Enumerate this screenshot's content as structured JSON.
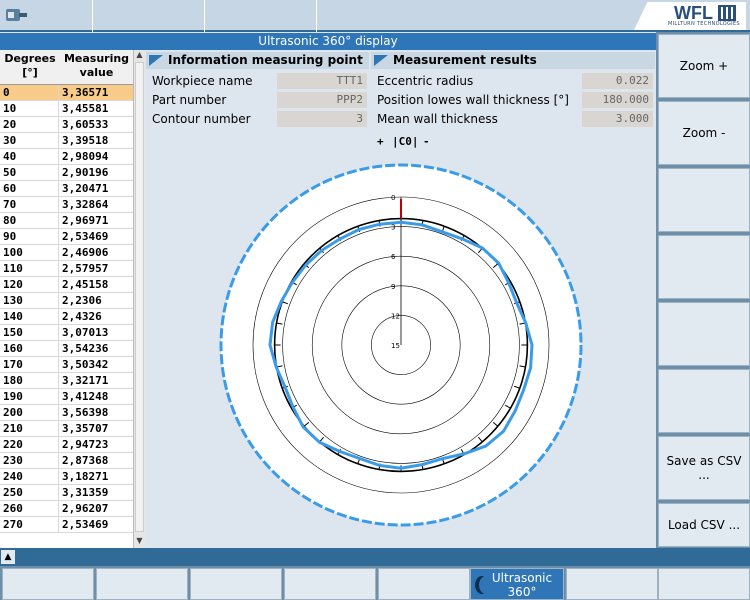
{
  "window": {
    "title": "Ultrasonic 360° display"
  },
  "logo": {
    "text": "WFL",
    "subtitle": "MILLTURN TECHNOLOGIES"
  },
  "table": {
    "col1_header": "Degrees\n[°]",
    "col2_header": "Measuring\nvalue",
    "selected_row": 0,
    "rows": [
      [
        "0",
        "3,36571"
      ],
      [
        "10",
        "3,45581"
      ],
      [
        "20",
        "3,60533"
      ],
      [
        "30",
        "3,39518"
      ],
      [
        "40",
        "2,98094"
      ],
      [
        "50",
        "2,90196"
      ],
      [
        "60",
        "3,20471"
      ],
      [
        "70",
        "3,32864"
      ],
      [
        "80",
        "2,96971"
      ],
      [
        "90",
        "2,53469"
      ],
      [
        "100",
        "2,46906"
      ],
      [
        "110",
        "2,57957"
      ],
      [
        "120",
        "2,45158"
      ],
      [
        "130",
        "2,2306"
      ],
      [
        "140",
        "2,4326"
      ],
      [
        "150",
        "3,07013"
      ],
      [
        "160",
        "3,54236"
      ],
      [
        "170",
        "3,50342"
      ],
      [
        "180",
        "3,32171"
      ],
      [
        "190",
        "3,41248"
      ],
      [
        "200",
        "3,56398"
      ],
      [
        "210",
        "3,35707"
      ],
      [
        "220",
        "2,94723"
      ],
      [
        "230",
        "2,87368"
      ],
      [
        "240",
        "3,18271"
      ],
      [
        "250",
        "3,31359"
      ],
      [
        "260",
        "2,96207"
      ],
      [
        "270",
        "2,53469"
      ]
    ]
  },
  "info_measuring_point": {
    "title": "Information measuring point",
    "fields": [
      {
        "label": "Workpiece name",
        "value": "TTT1"
      },
      {
        "label": "Part number",
        "value": "PPP2"
      },
      {
        "label": "Contour number",
        "value": "3"
      }
    ]
  },
  "measurement_results": {
    "title": "Measurement results",
    "fields": [
      {
        "label": "Eccentric radius",
        "value": "0.022"
      },
      {
        "label": "Position lowes wall thickness [°]",
        "value": "180.000"
      },
      {
        "label": "Mean wall thickness",
        "value": "3.000"
      }
    ]
  },
  "chart_header": {
    "plus": "+",
    "channel": "|C0|",
    "minus": "-"
  },
  "chart_data": {
    "type": "polar",
    "radial_ticks": [
      0,
      3,
      6,
      9,
      12,
      15
    ],
    "radial_range": [
      0,
      15
    ],
    "angles_deg": [
      0,
      10,
      20,
      30,
      40,
      50,
      60,
      70,
      80,
      90,
      100,
      110,
      120,
      130,
      140,
      150,
      160,
      170,
      180,
      190,
      200,
      210,
      220,
      230,
      240,
      250,
      260,
      270,
      280,
      290,
      300,
      310,
      320,
      330,
      340,
      350
    ],
    "measured_values": [
      3.36571,
      3.45581,
      3.60533,
      3.39518,
      2.98094,
      2.90196,
      3.20471,
      3.32864,
      2.96971,
      2.53469,
      2.46906,
      2.57957,
      2.45158,
      2.2306,
      2.4326,
      3.07013,
      3.54236,
      3.50342,
      3.32171,
      3.41248,
      3.56398,
      3.35707,
      2.94723,
      2.87368,
      3.18271,
      3.31359,
      2.96207,
      2.53469,
      2.6,
      2.9,
      3.1,
      3.2,
      3.3,
      3.4,
      3.35,
      3.38
    ],
    "nominal_value": 3.0,
    "colors": {
      "measured": "#3a9be8",
      "nominal": "#000000",
      "marker": "#c00000",
      "grid": "#000000"
    }
  },
  "softkeys_right": [
    "Zoom +",
    "Zoom -",
    "",
    "",
    "",
    "",
    "Save as CSV ...",
    "Load CSV ..."
  ],
  "softkeys_bottom": [
    "",
    "",
    "",
    "",
    "",
    "Ultrasonic\n360°",
    "",
    ""
  ],
  "icons": {
    "tool": "micrometer-icon",
    "scroll_up": "arrow-up-icon",
    "scroll_down": "arrow-down-icon",
    "caret_up": "caret-up-icon"
  }
}
